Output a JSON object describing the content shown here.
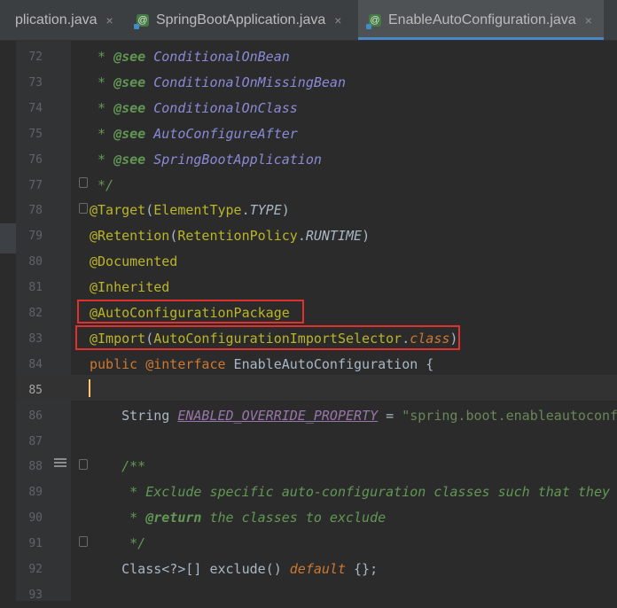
{
  "tabs": [
    {
      "label": "plication.java",
      "close": "×",
      "active": false,
      "icon": "none"
    },
    {
      "label": "SpringBootApplication.java",
      "close": "×",
      "active": false,
      "icon": "annotation-file-icon"
    },
    {
      "label": "EnableAutoConfiguration.java",
      "close": "×",
      "active": true,
      "icon": "annotation-file-icon"
    }
  ],
  "icon_glyph": "@",
  "colors": {
    "background": "#2b2b2b",
    "gutter": "#313335",
    "annotation": "#bbb529",
    "keyword": "#cc7832",
    "doc": "#629755",
    "highlight_box": "#e03131",
    "caret": "#ffc66d",
    "tab_underline": "#4a88c7"
  },
  "lines": [
    {
      "num": "72",
      "segments": [
        {
          "t": " * ",
          "c": "doc"
        },
        {
          "t": "@see",
          "c": "doctag"
        },
        {
          "t": " ConditionalOnBean",
          "c": "docref"
        }
      ]
    },
    {
      "num": "73",
      "segments": [
        {
          "t": " * ",
          "c": "doc"
        },
        {
          "t": "@see",
          "c": "doctag"
        },
        {
          "t": " ConditionalOnMissingBean",
          "c": "docref"
        }
      ]
    },
    {
      "num": "74",
      "segments": [
        {
          "t": " * ",
          "c": "doc"
        },
        {
          "t": "@see",
          "c": "doctag"
        },
        {
          "t": " ConditionalOnClass",
          "c": "docref"
        }
      ]
    },
    {
      "num": "75",
      "segments": [
        {
          "t": " * ",
          "c": "doc"
        },
        {
          "t": "@see",
          "c": "doctag"
        },
        {
          "t": " AutoConfigureAfter",
          "c": "docref"
        }
      ]
    },
    {
      "num": "76",
      "segments": [
        {
          "t": " * ",
          "c": "doc"
        },
        {
          "t": "@see",
          "c": "doctag"
        },
        {
          "t": " SpringBootApplication",
          "c": "docref"
        }
      ]
    },
    {
      "num": "77",
      "segments": [
        {
          "t": " */",
          "c": "doc"
        }
      ]
    },
    {
      "num": "78",
      "segments": [
        {
          "t": "@Target",
          "c": "ann"
        },
        {
          "t": "(",
          "c": "plain"
        },
        {
          "t": "ElementType",
          "c": "ann"
        },
        {
          "t": ".",
          "c": "plain"
        },
        {
          "t": "TYPE",
          "c": "plain it"
        },
        {
          "t": ")",
          "c": "plain"
        }
      ]
    },
    {
      "num": "79",
      "segments": [
        {
          "t": "@Retention",
          "c": "ann"
        },
        {
          "t": "(",
          "c": "plain"
        },
        {
          "t": "RetentionPolicy",
          "c": "ann"
        },
        {
          "t": ".",
          "c": "plain"
        },
        {
          "t": "RUNTIME",
          "c": "plain it"
        },
        {
          "t": ")",
          "c": "plain"
        }
      ]
    },
    {
      "num": "80",
      "segments": [
        {
          "t": "@Documented",
          "c": "ann"
        }
      ]
    },
    {
      "num": "81",
      "segments": [
        {
          "t": "@Inherited",
          "c": "ann"
        }
      ]
    },
    {
      "num": "82",
      "segments": [
        {
          "t": "@AutoConfigurationPackage",
          "c": "ann"
        }
      ]
    },
    {
      "num": "83",
      "segments": [
        {
          "t": "@Import",
          "c": "ann"
        },
        {
          "t": "(",
          "c": "plain"
        },
        {
          "t": "AutoConfigurationImportSelector",
          "c": "ann"
        },
        {
          "t": ".",
          "c": "plain"
        },
        {
          "t": "class",
          "c": "kw it"
        },
        {
          "t": ")",
          "c": "plain"
        }
      ]
    },
    {
      "num": "84",
      "segments": [
        {
          "t": "public",
          "c": "kw"
        },
        {
          "t": " ",
          "c": "plain"
        },
        {
          "t": "@interface",
          "c": "kw"
        },
        {
          "t": " EnableAutoConfiguration {",
          "c": "plain"
        }
      ]
    },
    {
      "num": "85",
      "segments": [],
      "current": true
    },
    {
      "num": "86",
      "segments": [
        {
          "t": "    String ",
          "c": "plain"
        },
        {
          "t": "ENABLED_OVERRIDE_PROPERTY",
          "c": "const"
        },
        {
          "t": " = ",
          "c": "plain"
        },
        {
          "t": "\"spring.boot.enableautoconf",
          "c": "str"
        }
      ]
    },
    {
      "num": "87",
      "segments": []
    },
    {
      "num": "88",
      "segments": [
        {
          "t": "    /**",
          "c": "doc"
        }
      ]
    },
    {
      "num": "89",
      "segments": [
        {
          "t": "     * Exclude specific auto-configuration classes such that they",
          "c": "doc"
        }
      ]
    },
    {
      "num": "90",
      "segments": [
        {
          "t": "     * ",
          "c": "doc"
        },
        {
          "t": "@return",
          "c": "doctag"
        },
        {
          "t": " the classes to exclude",
          "c": "doc"
        }
      ]
    },
    {
      "num": "91",
      "segments": [
        {
          "t": "     */",
          "c": "doc"
        }
      ]
    },
    {
      "num": "92",
      "segments": [
        {
          "t": "    Class",
          "c": "plain"
        },
        {
          "t": "<?>",
          "c": "plain"
        },
        {
          "t": "[] ",
          "c": "plain"
        },
        {
          "t": "exclude",
          "c": "plain"
        },
        {
          "t": "() ",
          "c": "plain"
        },
        {
          "t": "default",
          "c": "kw it"
        },
        {
          "t": " {};",
          "c": "plain"
        }
      ]
    },
    {
      "num": "93",
      "segments": []
    }
  ]
}
